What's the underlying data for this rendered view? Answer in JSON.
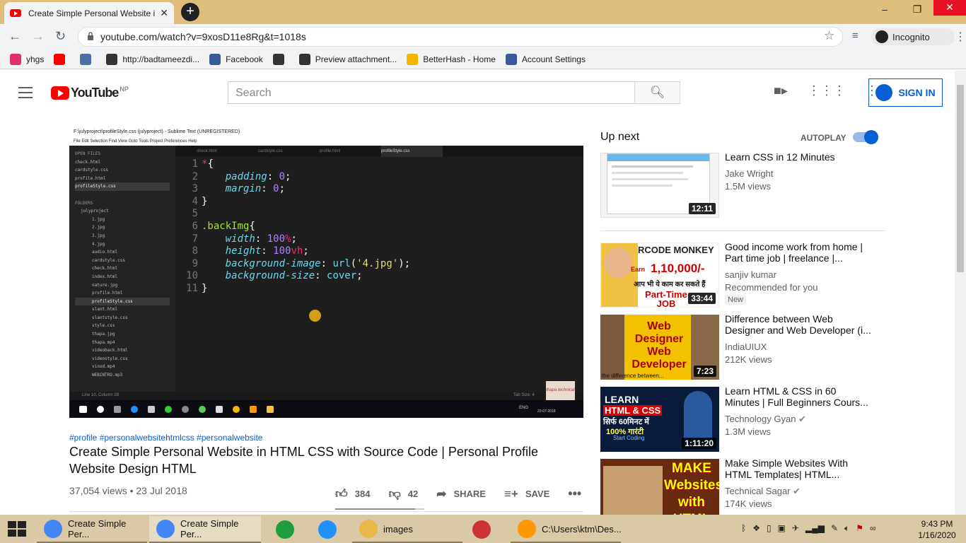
{
  "browser": {
    "tab_title": "Create Simple Personal Website i",
    "new_tab": "+",
    "url": "youtube.com/watch?v=9xosD11e8Rg&t=1018s",
    "incognito_label": "Incognito",
    "bookmarks": [
      {
        "label": "yhgs",
        "color": "#e1306c"
      },
      {
        "label": "",
        "color": "#ff0000"
      },
      {
        "label": "",
        "color": "#4a6fa5"
      },
      {
        "label": "http://badtameezdi...",
        "color": "#333333"
      },
      {
        "label": "Facebook",
        "color": "#3b5998"
      },
      {
        "label": "",
        "color": "#333333"
      },
      {
        "label": "Preview attachment...",
        "color": "#333333"
      },
      {
        "label": "BetterHash - Home",
        "color": "#f4b400"
      },
      {
        "label": "Account Settings",
        "color": "#3b5998"
      }
    ]
  },
  "youtube": {
    "logo_text": "YouTube",
    "country_code": "NP",
    "search_placeholder": "Search",
    "sign_in": "SIGN IN"
  },
  "video_frame": {
    "window_title": "F:\\julyproject\\profileStyle.css (julyproject) - Sublime Text (UNREGISTERED)",
    "menu": "File   Edit   Selection   Find   View   Goto   Tools   Project   Preferences   Help",
    "open_files_header": "OPEN FILES",
    "open_files": [
      "check.html",
      "cardstyle.css",
      "profile.html",
      "profileStyle.css"
    ],
    "folders_header": "FOLDERS",
    "folder_name": "julyproject",
    "folder_files": [
      "1.jpg",
      "2.jpg",
      "3.jpg",
      "4.jpg",
      "audio.html",
      "cardstyle.css",
      "check.html",
      "index.html",
      "nature.jpg",
      "profile.html",
      "profileStyle.css",
      "slant.html",
      "slantstyle.css",
      "style.css",
      "thapa.jpg",
      "thapa.mp4",
      "videoback.html",
      "videostyle.css",
      "vinod.mp4",
      "WEBINTRO.mp3"
    ],
    "editor_tabs": [
      "check.html",
      "cardstyle.css",
      "profile.html",
      "profileStyle.css"
    ],
    "line_numbers": [
      "1",
      "2",
      "3",
      "4",
      "5",
      "6",
      "7",
      "8",
      "9",
      "10",
      "11"
    ],
    "status_left": "Line 10, Column 28",
    "status_right": "Tab Size: 4",
    "watermark": "thapa technical",
    "task_date": "23-07-2018",
    "task_lang": "ENG"
  },
  "video": {
    "hashtags": "#profile #personalwebsitehtmlcss #personalwebsite",
    "title": "Create Simple Personal Website in HTML CSS with Source Code | Personal Profile Website Design HTML",
    "views_date": "37,054 views • 23 Jul 2018",
    "likes": "384",
    "dislikes": "42",
    "share": "SHARE",
    "save": "SAVE",
    "like_ratio": 0.9
  },
  "sidebar": {
    "up_next": "Up next",
    "autoplay": "AUTOPLAY",
    "autoplay_on": true,
    "items": [
      {
        "title": "Learn CSS in 12 Minutes",
        "channel": "Jake Wright",
        "views": "1.5M views",
        "duration": "12:11"
      },
      {
        "title": "Good income work from home | Part time job | freelance |...",
        "channel": "sanjiv kumar",
        "views": "Recommended for you",
        "badge": "New",
        "duration": "33:44",
        "thumb_text_1": "RCODE MONKEY",
        "thumb_text_2": "Earn",
        "thumb_text_3": "1,10,000/-",
        "thumb_text_4": "आप भी ये काम कर सकते हैं",
        "thumb_text_5": "Part-Time JOB"
      },
      {
        "title": "Difference between Web Designer and Web Developer (i...",
        "channel": "IndiaUIUX",
        "views": "212K views",
        "duration": "7:23",
        "thumb_text_1": "Web Designer",
        "thumb_text_2": "Web Developer",
        "thumb_text_3": "the difference between..."
      },
      {
        "title": "Learn HTML & CSS in 60 Minutes | Full Beginners Cours...",
        "channel": "Technology Gyan",
        "views": "1.3M views",
        "duration": "1:11:20",
        "thumb_text_1": "LEARN",
        "thumb_text_2": "HTML & CSS",
        "thumb_text_3": "सिर्फ 60मिनट में",
        "thumb_text_4": "100% गारंटी",
        "thumb_text_5": "Start Coding"
      },
      {
        "title": "Make Simple Websites With HTML Templates| HTML...",
        "channel": "Technical Sagar",
        "views": "174K views",
        "thumb_text_1": "MAKE Websites with HTML"
      }
    ]
  },
  "taskbar": {
    "apps": [
      "Create Simple Per...",
      "Create Simple Per...",
      "",
      "",
      "images",
      "",
      "C:\\Users\\ktm\\Des..."
    ],
    "time": "9:43 PM",
    "date": "1/16/2020"
  }
}
